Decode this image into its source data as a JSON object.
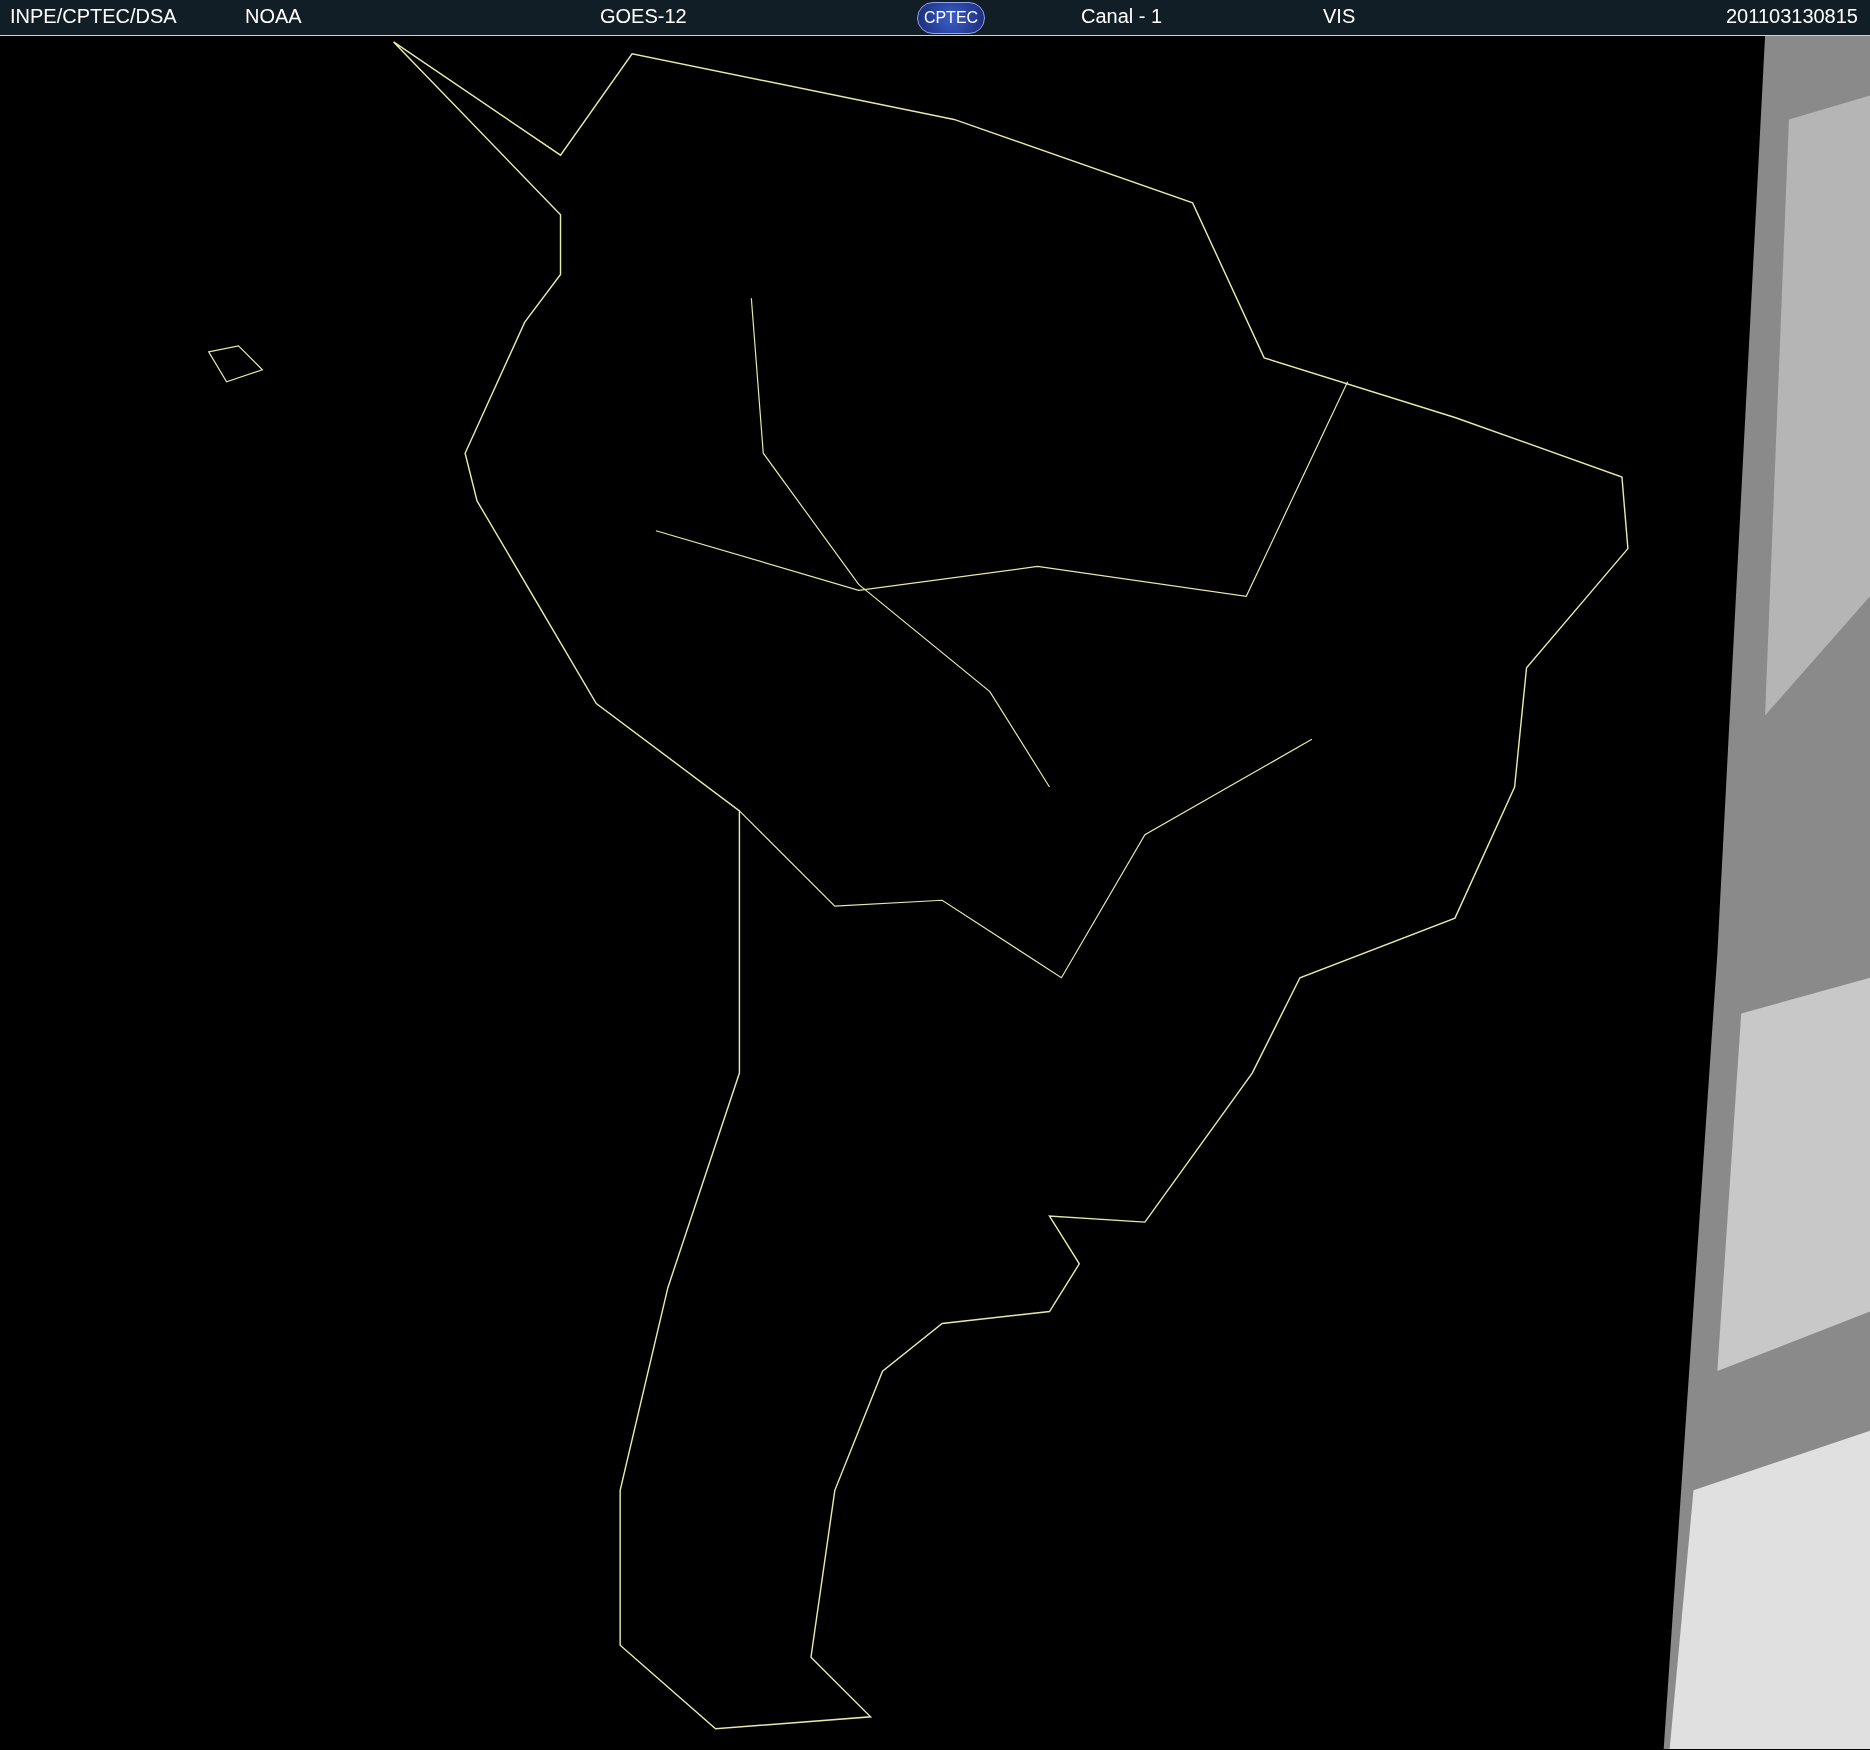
{
  "header": {
    "items": [
      {
        "kind": "text",
        "text": "INPE/CPTEC/DSA"
      },
      {
        "kind": "text",
        "text": "NOAA"
      },
      {
        "kind": "text",
        "text": "GOES-12"
      },
      {
        "kind": "logo",
        "text": "CPTEC"
      },
      {
        "kind": "text",
        "text": "Canal - 1"
      },
      {
        "kind": "text",
        "text": "VIS"
      },
      {
        "kind": "text",
        "text": "201103130815"
      }
    ]
  }
}
